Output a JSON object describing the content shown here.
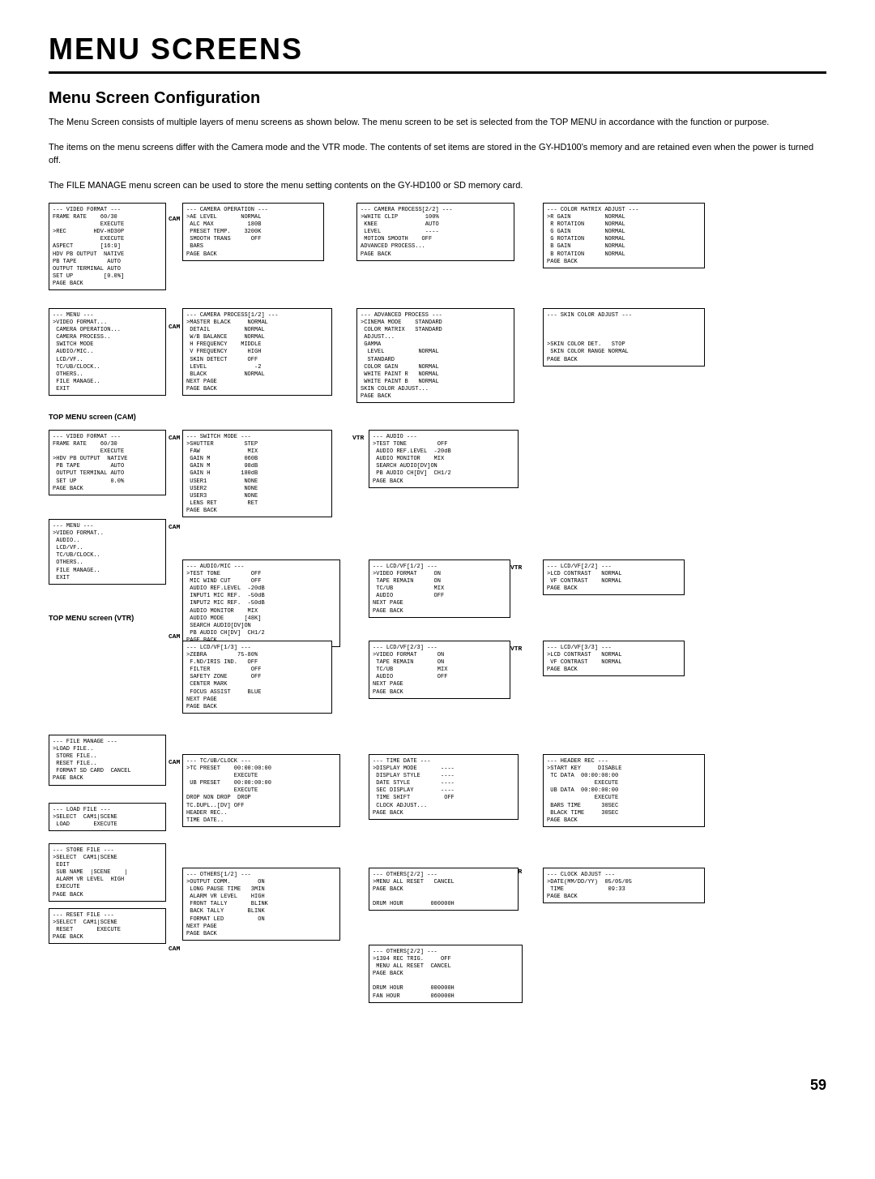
{
  "page": {
    "main_title": "MENU SCREENS",
    "section_title": "Menu Screen Configuration",
    "description_1": "The Menu Screen consists of multiple layers of menu screens as shown below. The menu screen to be set is selected from the TOP MENU in accordance with the function or purpose.",
    "description_2": "The items on the menu screens differ with the Camera mode and the VTR mode. The contents of set items are stored in the GY-HD100's memory and are retained even when the power is turned off.",
    "description_3": "The FILE MANAGE menu screen can be used to store the menu setting contents on the GY-HD100 or SD memory card.",
    "page_number": "59"
  },
  "boxes": {
    "video_format_cam": "--- VIDEO FORMAT ---\nFRAME RATE    60/30\n              EXECUTE\n>REC        HDV-HD30P\n              EXECUTE\nASPECT        [16:9]\nHDV PB OUTPUT  NATIVE\nPB TAPE         AUTO\nOUTPUT TERMINAL AUTO\nSET UP         [0.0%]\nPAGE BACK",
    "camera_operation": "--- CAMERA OPERATION ---\n>AE LEVEL       NORMAL\n ALC MAX          180B\n PRESET TEMP.    3200K\n SMOOTH TRANS      OFF\n BARS\nPAGE BACK",
    "camera_process_2_2": "--- CAMERA PROCESS[2/2] ---\n>WHITE CLIP        100%\n KNEE              AUTO\n LEVEL             ----\n MOTION SMOOTH    OFF\nADVANCED PROCESS...\nPAGE BACK",
    "color_matrix_adjust": "--- COLOR MATRIX ADJUST ---\n>R GAIN          NORMAL\n R ROTATION      NORMAL\n G GAIN          NORMAL\n G ROTATION      NORMAL\n B GAIN          NORMAL\n B ROTATION      NORMAL\nPAGE BACK",
    "top_menu_cam": "--- MENU ---\n>VIDEO FORMAT...\n CAMERA OPERATION...\n CAMERA PROCESS..\n SWITCH MODE\n AUDIO/MIC..\n LCD/VF..\n TC/UB/CLOCK..\n OTHERS..\n FILE MANAGE..\n EXIT",
    "camera_process_1_2": "--- CAMERA PROCESS[1/2] ---\n>MASTER BLACK     NORMAL\n DETAIL          NORMAL\n W/B BALANCE     NORMAL\n H FREQUENCY    MIDDLE\n V FREQUENCY      HIGH\n SKIN DETECT      OFF\n LEVEL              -2\n BLACK           NORMAL\nNEXT PAGE\nPAGE BACK",
    "advanced_process": "--- ADVANCED PROCESS ---\n>CINEMA MODE    STANDARD\n COLOR MATRIX   STANDARD\n ADJUST...\n GAMMA\n  LEVEL          NORMAL\n  STANDARD\n COLOR GAIN      NORMAL\n WHITE PAINT R   NORMAL\n WHITE PAINT B   NORMAL\nSKIN COLOR ADJUST...\nPAGE BACK",
    "skin_color_adjust": "--- SKIN COLOR ADJUST ---\n\n\n\n>SKIN COLOR DET.   STOP\n SKIN COLOR RANGE NORMAL\nPAGE BACK",
    "video_format_vtr": "--- VIDEO FORMAT ---\nFRAME RATE    60/30\n              EXECUTE\n>HDV PB OUTPUT  NATIVE\n PB TAPE         AUTO\n OUTPUT TERMINAL AUTO\n SET UP          0.0%\nPAGE BACK",
    "switch_mode": "--- SWITCH MODE ---\n>SHUTTER         STEP\n FAW              MIX\n GAIN M          060B\n GAIN M          98dB\n GAIN H         180dB\n USER1           NONE\n USER2           NONE\n USER3           NONE\n LENS RET         RET\nPAGE BACK",
    "audio_vtr": "--- AUDIO ---\n>TEST TONE         OFF\n AUDIO REF.LEVEL  -20dB\n AUDIO MONITOR    MIX\n SEARCH AUDIO[DV]ON\n PB AUDIO CH[DV]  CH1/2\nPAGE BACK",
    "top_menu_vtr": "--- MENU ---\n>VIDEO FORMAT..\n AUDIO..\n LCD/VF..\n TC/UB/CLOCK..\n OTHERS..\n FILE MANAGE..\n EXIT",
    "audio_mic": "--- AUDIO/MIC ---\n>TEST TONE         OFF\n MIC WIND CUT      OFF\n AUDIO REF.LEVEL  -20dB\n INPUT1 MIC REF.  -50dB\n INPUT2 MIC REF.  -50dB\n AUDIO MONITOR    MIX\n AUDIO MODE      [48K]\n SEARCH AUDIO[DV]ON\n PB AUDIO CH[DV]  CH1/2\nPAGE BACK",
    "lcd_vf_1_2_cam": "--- LCD/VF[1/2] ---\n>VIDEO FORMAT     ON\n TAPE REMAIN      ON\n TC/UB            MIX\n AUDIO            OFF\nNEXT PAGE\nPAGE BACK",
    "lcd_vf_2_2_right": "--- LCD/VF[2/2] ---\n>LCD CONTRAST   NORMAL\n VF CONTRAST    NORMAL\nPAGE BACK",
    "lcd_vf_1_3": "--- LCD/VF[1/3] ---\n>ZEBRA         75-80%\n F.ND/IRIS IND.   OFF\n FILTER            OFF\n SAFETY ZONE       OFF\n CENTER MARK\n FOCUS ASSIST     BLUE\nNEXT PAGE\nPAGE BACK",
    "lcd_vf_2_3": "--- LCD/VF[2/3] ---\n>VIDEO FORMAT      ON\n TAPE REMAIN       ON\n TC/UB             MIX\n AUDIO             OFF\nNEXT PAGE\nPAGE BACK",
    "lcd_vf_3_3": "--- LCD/VF[3/3] ---\n>LCD CONTRAST   NORMAL\n VF CONTRAST    NORMAL\nPAGE BACK",
    "file_manage": "--- FILE MANAGE ---\n>LOAD FILE..\n STORE FILE..\n RESET FILE..\n FORMAT SD CARD  CANCEL\nPAGE BACK",
    "load_file": "--- LOAD FILE ---\n>SELECT  CAM1|SCENE\n LOAD       EXECUTE",
    "store_file": "--- STORE FILE ---\n>SELECT  CAM1|SCENE\n EDIT\n SUB NAME  |SCENE    |\n ALARM VR LEVEL  HIGH\n EXECUTE\nPAGE BACK",
    "reset_file": "--- RESET FILE ---\n>SELECT  CAM1|SCENE\n RESET       EXECUTE\nPAGE BACK",
    "tc_ub_clock": "--- TC/UB/CLOCK ---\n>TC PRESET    00:00:00:00\n              EXECUTE\n UB PRESET    00:00:00:00\n              EXECUTE\nDROP NON DROP  DROP\nTC.DUPL..[DV] OFF\nHEADER REC..\nTIME DATE..",
    "time_date": "--- TIME DATE ---\n>DISPLAY MODE       ----\n DISPLAY STYLE      ----\n DATE STYLE         ----\n SEC DISPLAY        ----\n TIME SHIFT          OFF\n CLOCK ADJUST...\nPAGE BACK",
    "header_rec": "--- HEADER REC ---\n>START KEY     DISABLE\n TC DATA  00:00:00:00\n              EXECUTE\n UB DATA  00:00:00:00\n              EXECUTE\n BARS TIME      30SEC\n BLACK TIME     30SEC\nPAGE BACK",
    "others_1_2": "--- OTHERS[1/2] ---\n>OUTPUT COMM.        ON\n LONG PAUSE TIME   3MIN\n ALARM VR LEVEL    HIGH\n FRONT TALLY       BLINK\n BACK TALLY       BLINK\n FORMAT LED          ON\nNEXT PAGE\nPAGE BACK",
    "others_2_2_vtr": "--- OTHERS[2/2] ---\n>MENU ALL RESET   CANCEL\nPAGE BACK\n\nDRUM HOUR        000000H",
    "others_2_2_cam": "--- OTHERS[2/2] ---\n>1394 REC TRIG.     OFF\n MENU ALL RESET  CANCEL\nPAGE BACK\n\nDRUM HOUR        000000H\nFAN HOUR         060000H",
    "clock_adjust": "--- CLOCK ADJUST ---\n>DATE(MM/DD/YY)  05/05/05\n TIME             09:33\nPAGE BACK"
  },
  "labels": {
    "cam": "CAM",
    "vtr": "VTR",
    "top_menu_cam": "TOP MENU screen (CAM)",
    "top_menu_vtr": "TOP MENU screen (VTR)"
  }
}
